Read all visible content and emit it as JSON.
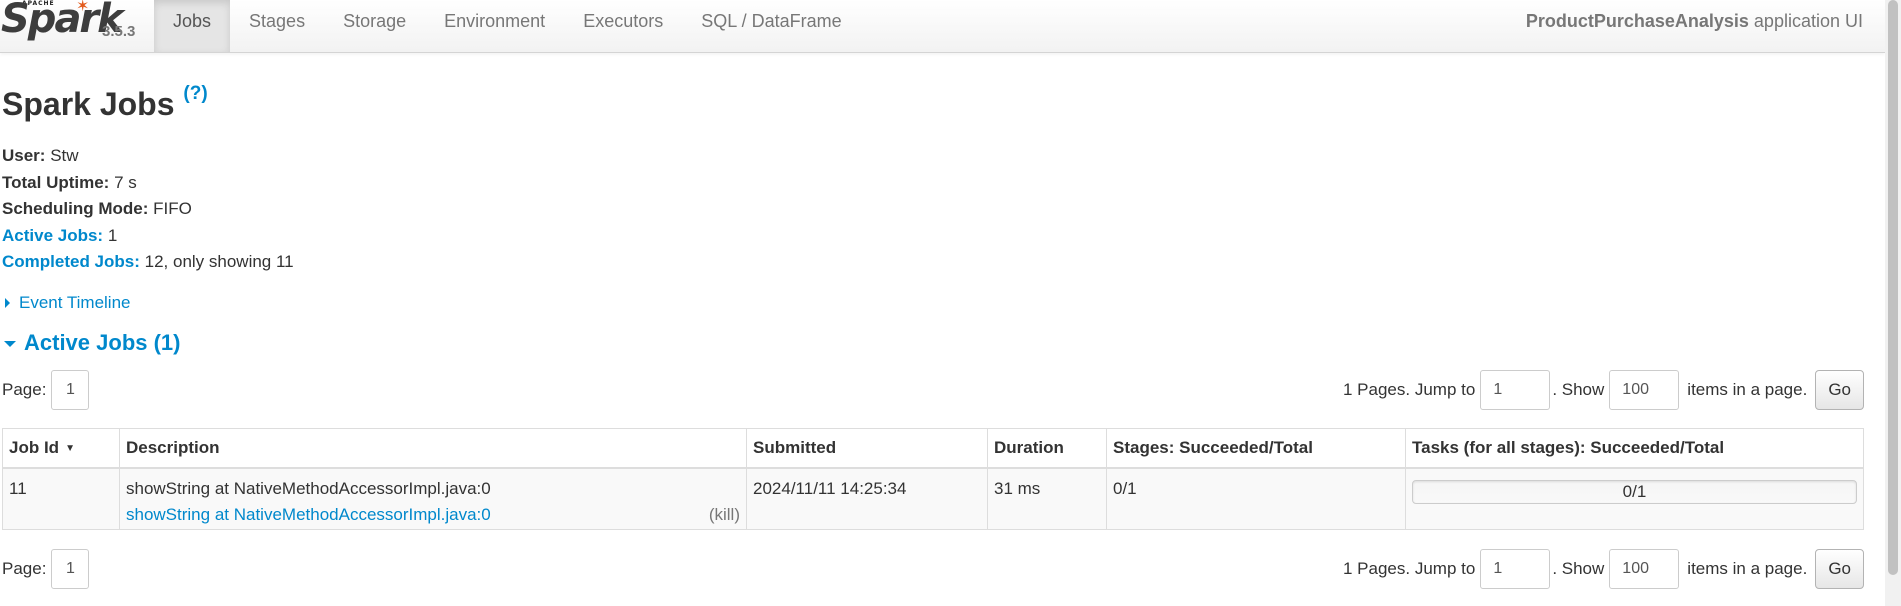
{
  "brand": {
    "apache": "APACHE",
    "name": "Spark",
    "version": "3.5.3"
  },
  "nav": {
    "items": [
      "Jobs",
      "Stages",
      "Storage",
      "Environment",
      "Executors",
      "SQL / DataFrame"
    ],
    "active": "Jobs"
  },
  "app": {
    "name": "ProductPurchaseAnalysis",
    "suffix": " application UI"
  },
  "page": {
    "title": "Spark Jobs",
    "help": "(?)"
  },
  "summary": {
    "user_label": "User:",
    "user": " Stw",
    "uptime_label": "Total Uptime:",
    "uptime": " 7 s",
    "mode_label": "Scheduling Mode:",
    "mode": " FIFO",
    "active_label": "Active Jobs:",
    "active": " 1",
    "completed_label": "Completed Jobs:",
    "completed": " 12, only showing 11"
  },
  "timeline": {
    "label": "Event Timeline"
  },
  "active_section": {
    "title": "Active Jobs (1)"
  },
  "pagination": {
    "page_label": "Page:",
    "page": "1",
    "pages_text": "1 Pages. Jump to",
    "jump_value": "1",
    "show_text": ". Show",
    "show_value": "100",
    "items_text": "items in a page.",
    "go": "Go"
  },
  "table": {
    "headers": [
      "Job Id",
      "Description",
      "Submitted",
      "Duration",
      "Stages: Succeeded/Total",
      "Tasks (for all stages): Succeeded/Total"
    ],
    "rows": [
      {
        "job_id": "11",
        "description": "showString at NativeMethodAccessorImpl.java:0",
        "description_link": "showString at NativeMethodAccessorImpl.java:0",
        "kill": "(kill)",
        "submitted": "2024/11/11 14:25:34",
        "duration": "31 ms",
        "stages": "0/1",
        "tasks": "0/1",
        "tasks_progress": 0
      }
    ]
  },
  "colors": {
    "link": "#0088cc",
    "nav_active_bg": "#e5e5e5",
    "progress_fill": "#a0dfff"
  }
}
